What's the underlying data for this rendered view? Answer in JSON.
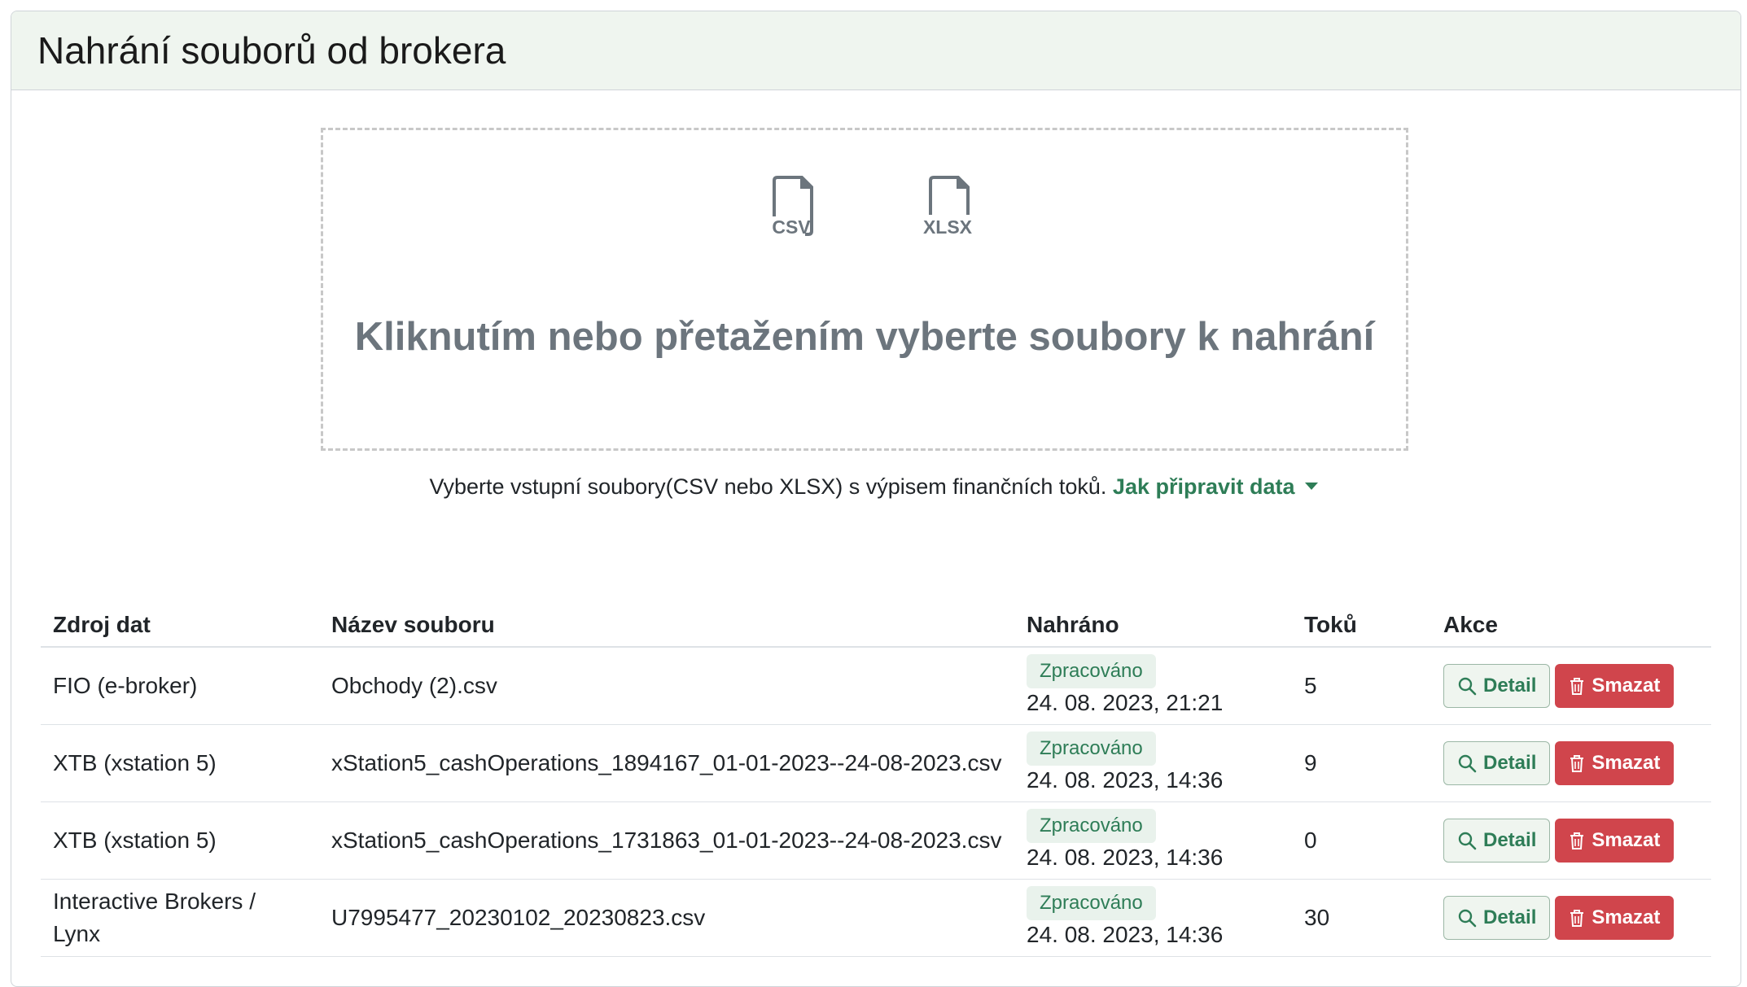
{
  "header": {
    "title": "Nahrání souborů od brokera"
  },
  "dropzone": {
    "icons": [
      {
        "icon": "csv-file-icon",
        "label": "CSV"
      },
      {
        "icon": "xlsx-file-icon",
        "label": "XLSX"
      }
    ],
    "text": "Kliknutím nebo přetažením vyberte soubory k nahrání"
  },
  "hint": {
    "text": "Vyberte vstupní soubory(CSV nebo XLSX) s výpisem finančních toků.",
    "link": "Jak připravit data"
  },
  "table": {
    "headers": [
      "Zdroj dat",
      "Název souboru",
      "Nahráno",
      "Toků",
      "Akce"
    ],
    "detail_label": "Detail",
    "delete_label": "Smazat",
    "rows": [
      {
        "source": "FIO (e-broker)",
        "file": "Obchody (2).csv",
        "status": "Zpracováno",
        "date": "24. 08. 2023, 21:21",
        "count": "5"
      },
      {
        "source": "XTB (xstation 5)",
        "file": "xStation5_cashOperations_1894167_01-01-2023--24-08-2023.csv",
        "status": "Zpracováno",
        "date": "24. 08. 2023, 14:36",
        "count": "9"
      },
      {
        "source": "XTB (xstation 5)",
        "file": "xStation5_cashOperations_1731863_01-01-2023--24-08-2023.csv",
        "status": "Zpracováno",
        "date": "24. 08. 2023, 14:36",
        "count": "0"
      },
      {
        "source": "Interactive Brokers / Lynx",
        "file": "U7995477_20230102_20230823.csv",
        "status": "Zpracováno",
        "date": "24. 08. 2023, 14:36",
        "count": "30"
      }
    ]
  },
  "colors": {
    "accent": "#2e7d57",
    "danger": "#d0454c",
    "header_bg": "#eff5ef"
  }
}
